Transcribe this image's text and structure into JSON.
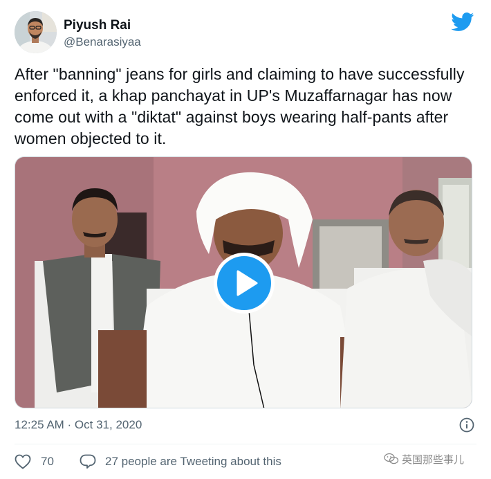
{
  "author": {
    "display_name": "Piyush Rai",
    "handle": "@Benarasiyaa"
  },
  "tweet": {
    "text": "After \"banning\" jeans for girls and claiming to have successfully enforced it, a khap panchayat in UP's Muzaffarnagar has now come out with a \"diktat\" against boys wearing half-pants after women objected to it."
  },
  "meta": {
    "timestamp": "12:25 AM · Oct 31, 2020"
  },
  "engagement": {
    "likes": "70",
    "tweeting_about": "27 people are Tweeting about this"
  },
  "watermark": {
    "text": "英国那些事儿"
  },
  "colors": {
    "brand_blue": "#1d9bf0",
    "secondary_text": "#536471",
    "primary_text": "#0f1419"
  },
  "icons": {
    "brand": "twitter-bird-icon",
    "play": "play-icon",
    "info": "info-icon",
    "like": "heart-icon",
    "reply": "speech-bubble-icon"
  }
}
